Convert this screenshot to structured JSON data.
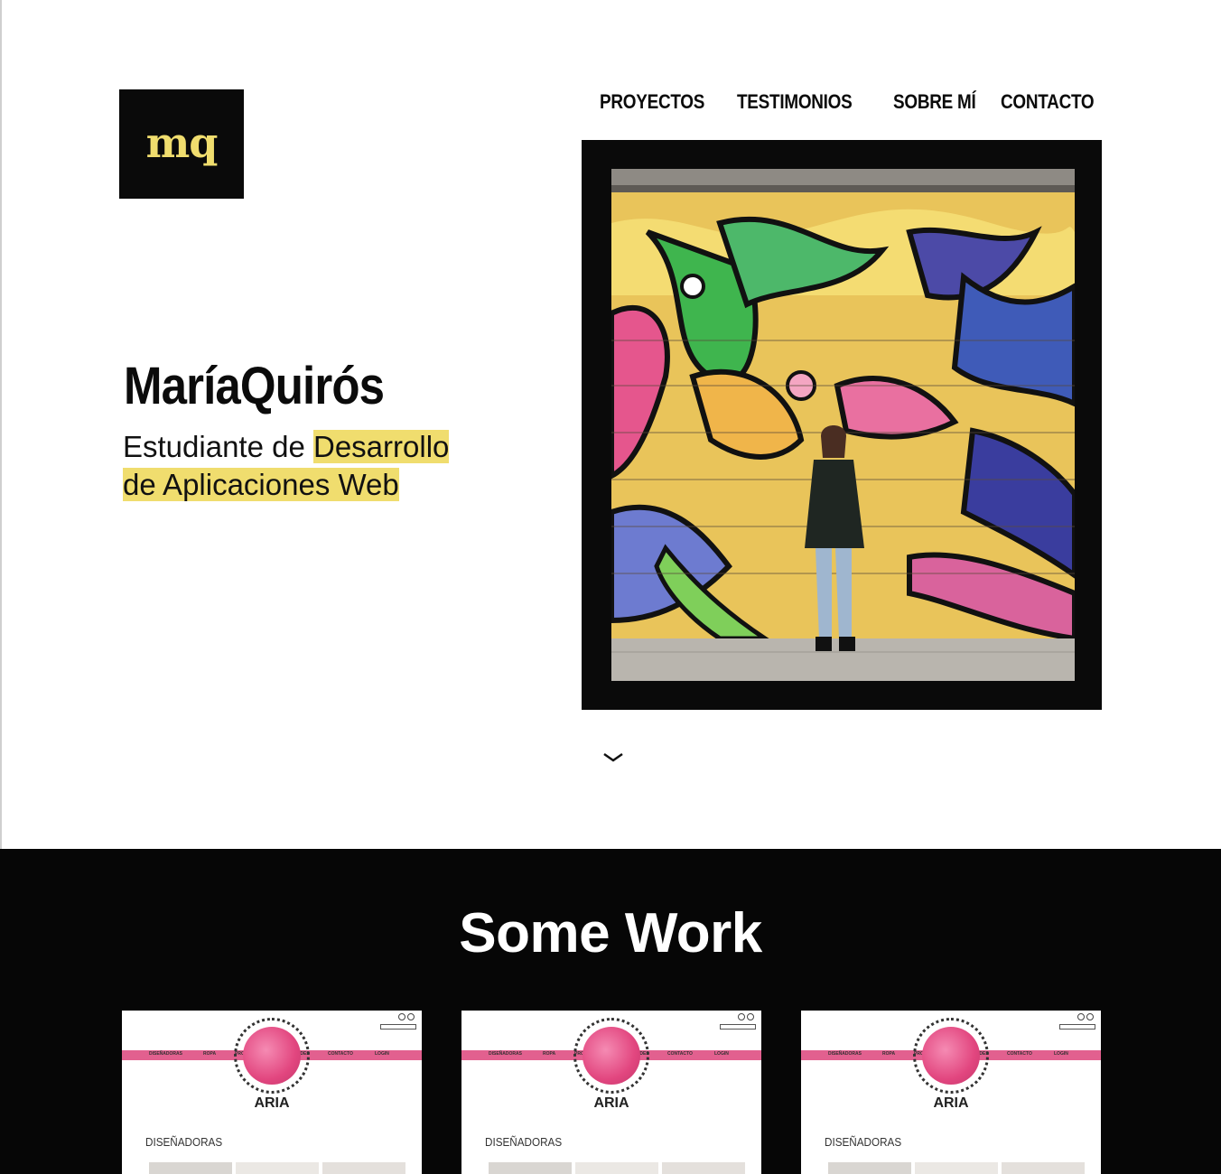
{
  "header": {
    "logo_text": "mq",
    "nav": [
      "PROYECTOS",
      "TESTIMONIOS",
      "SOBRE MÍ",
      "CONTACTO"
    ]
  },
  "hero": {
    "name": "MaríaQuirós",
    "subtitle_plain": "Estudiante de ",
    "subtitle_highlight_1": "Desarrollo ",
    "subtitle_highlight_2": "de Aplicaciones Web"
  },
  "work": {
    "title": "Some Work",
    "cards": [
      {
        "menu": [
          "DISEÑADORAS",
          "ROPA",
          "PROMOCIONES",
          "NOVEDADES",
          "CONTACTO",
          "LOGIN"
        ],
        "brand": "ARIA",
        "section": "DISEÑADORAS"
      },
      {
        "menu": [
          "DISEÑADORAS",
          "ROPA",
          "PROMOCIONES",
          "NOVEDADES",
          "CONTACTO",
          "LOGIN"
        ],
        "brand": "ARIA",
        "section": "DISEÑADORAS"
      },
      {
        "menu": [
          "DISEÑADORAS",
          "ROPA",
          "PROMOCIONES",
          "NOVEDADES",
          "CONTACTO",
          "LOGIN"
        ],
        "brand": "ARIA",
        "section": "DISEÑADORAS"
      }
    ]
  },
  "colors": {
    "accent": "#f0dd6e",
    "dark": "#060606",
    "card_band": "#e2608f"
  }
}
